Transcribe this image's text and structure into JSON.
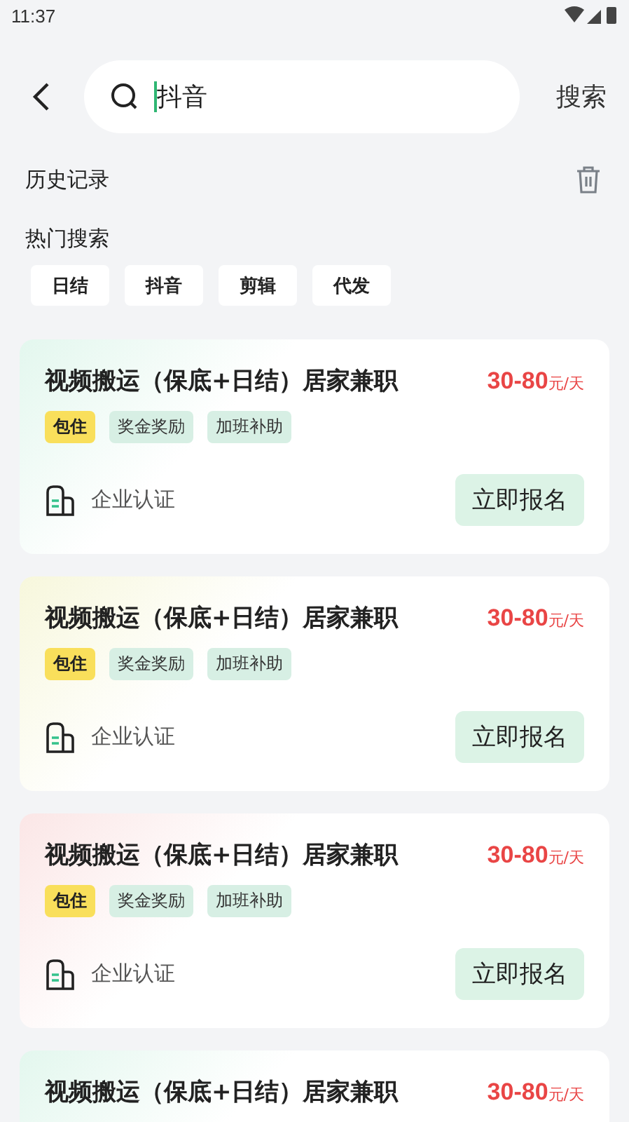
{
  "status_bar": {
    "time": "11:37"
  },
  "search": {
    "value": "抖音",
    "button": "搜索"
  },
  "history": {
    "title": "历史记录"
  },
  "hot": {
    "title": "热门搜索",
    "items": [
      "日结",
      "抖音",
      "剪辑",
      "代发"
    ]
  },
  "jobs": [
    {
      "title": "视频搬运（保底+日结）居家兼职",
      "price": "30-80",
      "unit": "元/天",
      "color": "#e3f7ee",
      "tags": [
        {
          "label": "包住",
          "kind": "yellow"
        },
        {
          "label": "奖金奖励",
          "kind": "green"
        },
        {
          "label": "加班补助",
          "kind": "green"
        }
      ],
      "verify": "企业认证",
      "action": "立即报名"
    },
    {
      "title": "视频搬运（保底+日结）居家兼职",
      "price": "30-80",
      "unit": "元/天",
      "color": "#f7f7dc",
      "tags": [
        {
          "label": "包住",
          "kind": "yellow"
        },
        {
          "label": "奖金奖励",
          "kind": "green"
        },
        {
          "label": "加班补助",
          "kind": "green"
        }
      ],
      "verify": "企业认证",
      "action": "立即报名"
    },
    {
      "title": "视频搬运（保底+日结）居家兼职",
      "price": "30-80",
      "unit": "元/天",
      "color": "#fbe6e6",
      "tags": [
        {
          "label": "包住",
          "kind": "yellow"
        },
        {
          "label": "奖金奖励",
          "kind": "green"
        },
        {
          "label": "加班补助",
          "kind": "green"
        }
      ],
      "verify": "企业认证",
      "action": "立即报名"
    },
    {
      "title": "视频搬运（保底+日结）居家兼职",
      "price": "30-80",
      "unit": "元/天",
      "color": "#e3f7ee"
    }
  ]
}
